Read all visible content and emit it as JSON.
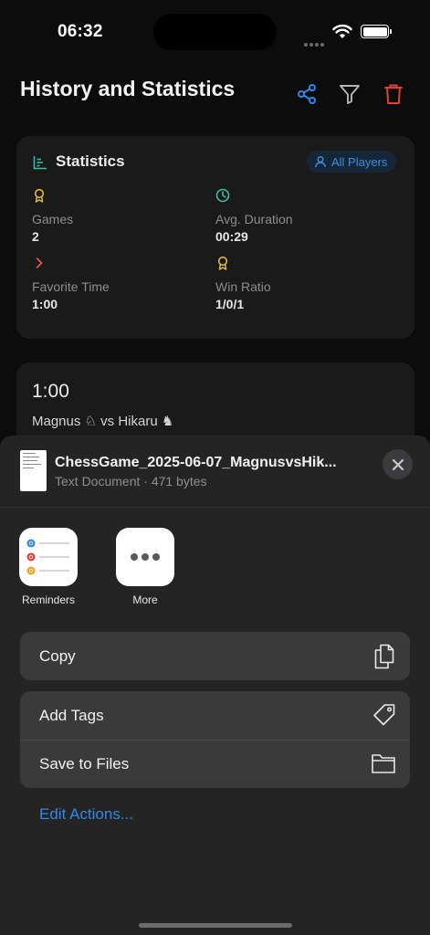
{
  "status_bar": {
    "time": "06:32"
  },
  "header": {
    "title": "History and Statistics"
  },
  "stats": {
    "title": "Statistics",
    "filter_label": "All Players",
    "items": [
      {
        "label": "Games",
        "value": "2",
        "icon": "award-icon",
        "color": "#e2b73c"
      },
      {
        "label": "Avg. Duration",
        "value": "00:29",
        "icon": "clock-icon",
        "color": "#3fb8a4"
      },
      {
        "label": "Favorite Time",
        "value": "1:00",
        "icon": "chevron-right-icon",
        "color": "#e35a4c"
      },
      {
        "label": "Win Ratio",
        "value": "1/0/1",
        "icon": "award-icon",
        "color": "#e2b73c"
      }
    ]
  },
  "game_card": {
    "time_control": "1:00",
    "players": "Magnus ♘ vs Hikaru ♞"
  },
  "share_sheet": {
    "file_name": "ChessGame_2025-06-07_MagnusvsHik...",
    "file_meta": "Text Document · 471 bytes",
    "apps": [
      {
        "label": "Reminders",
        "icon": "reminders-icon"
      },
      {
        "label": "More",
        "icon": "more-icon"
      }
    ],
    "actions": {
      "copy": "Copy",
      "add_tags": "Add Tags",
      "save_to_files": "Save to Files"
    },
    "edit_actions": "Edit Actions..."
  },
  "colors": {
    "accent_blue": "#2f89ea",
    "danger_red": "#e0403a",
    "sheet_bg": "#242424",
    "card_bg": "#1a1a1a"
  }
}
